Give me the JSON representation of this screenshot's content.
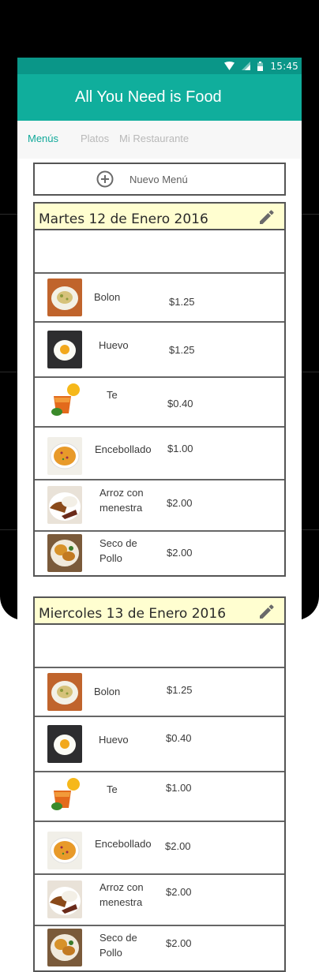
{
  "status_bar": {
    "time": "15:45"
  },
  "app": {
    "title": "All You Need is Food"
  },
  "tabs": [
    {
      "label": "Menús",
      "active": true
    },
    {
      "label": "Platos",
      "active": false
    },
    {
      "label": "Mi Restaurante",
      "active": false
    }
  ],
  "new_menu": {
    "label": "Nuevo Menú",
    "icon": "add-circle-icon"
  },
  "menus": [
    {
      "date": "Martes 12 de Enero 2016",
      "dishes": [
        {
          "name": "Bolon",
          "price": "$1.25",
          "image": "bolon"
        },
        {
          "name": "Huevo",
          "price": "$1.25",
          "image": "huevo"
        },
        {
          "name": "Te",
          "price": "$0.40",
          "image": "te"
        },
        {
          "name": "Encebollado",
          "price": "$1.00",
          "image": "encebollado"
        },
        {
          "name": "Arroz con\nmenestra",
          "price": "$2.00",
          "image": "arroz"
        },
        {
          "name": "Seco de\nPollo",
          "price": "$2.00",
          "image": "seco"
        }
      ]
    },
    {
      "date": "Miercoles  13 de Enero 2016",
      "dishes": [
        {
          "name": "Bolon",
          "price": "$1.25",
          "image": "bolon"
        },
        {
          "name": "Huevo",
          "price": "$0.40",
          "image": "huevo"
        },
        {
          "name": "Te",
          "price": "$1.00",
          "image": "te"
        },
        {
          "name": "Encebollado",
          "price": "$2.00",
          "image": "encebollado"
        },
        {
          "name": "Arroz con\nmenestra",
          "price": "$2.00",
          "image": "arroz"
        },
        {
          "name": "Seco de\nPollo",
          "price": "$2.00",
          "image": "seco"
        }
      ]
    }
  ],
  "colors": {
    "status_bar": "#0a9688",
    "app_bar": "#10ae9c",
    "active_tab": "#11a99a",
    "menu_header": "#fffed0"
  }
}
